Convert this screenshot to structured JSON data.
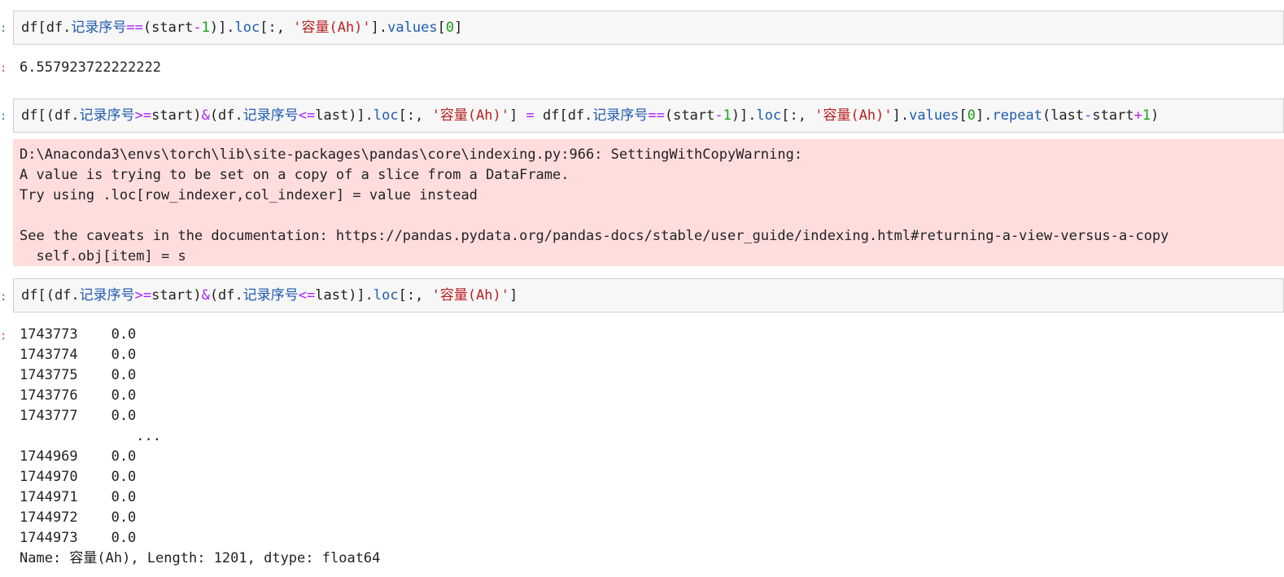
{
  "cells": [
    {
      "id": 1,
      "code_tokens": [
        {
          "t": "df[df.",
          "c": "nm"
        },
        {
          "t": "记录序号",
          "c": "at cjk"
        },
        {
          "t": "==",
          "c": "op"
        },
        {
          "t": "(start",
          "c": "nm"
        },
        {
          "t": "-",
          "c": "op"
        },
        {
          "t": "1",
          "c": "num"
        },
        {
          "t": ")].",
          "c": "nm"
        },
        {
          "t": "loc",
          "c": "at"
        },
        {
          "t": "[:, ",
          "c": "nm"
        },
        {
          "t": "'",
          "c": "str"
        },
        {
          "t": "容量",
          "c": "str cjk"
        },
        {
          "t": "(Ah)'",
          "c": "str"
        },
        {
          "t": "].",
          "c": "nm"
        },
        {
          "t": "values",
          "c": "at"
        },
        {
          "t": "[",
          "c": "nm"
        },
        {
          "t": "0",
          "c": "num"
        },
        {
          "t": "]",
          "c": "nm"
        }
      ],
      "output": "6.557923722222222"
    },
    {
      "id": 2,
      "code_tokens": [
        {
          "t": "df[(df.",
          "c": "nm"
        },
        {
          "t": "记录序号",
          "c": "at cjk"
        },
        {
          "t": ">=",
          "c": "op"
        },
        {
          "t": "start)",
          "c": "nm"
        },
        {
          "t": "&",
          "c": "op"
        },
        {
          "t": "(df.",
          "c": "nm"
        },
        {
          "t": "记录序号",
          "c": "at cjk"
        },
        {
          "t": "<=",
          "c": "op"
        },
        {
          "t": "last)].",
          "c": "nm"
        },
        {
          "t": "loc",
          "c": "at"
        },
        {
          "t": "[:, ",
          "c": "nm"
        },
        {
          "t": "'",
          "c": "str"
        },
        {
          "t": "容量",
          "c": "str cjk"
        },
        {
          "t": "(Ah)'",
          "c": "str"
        },
        {
          "t": "] ",
          "c": "nm"
        },
        {
          "t": "=",
          "c": "op"
        },
        {
          "t": " df[df.",
          "c": "nm"
        },
        {
          "t": "记录序号",
          "c": "at cjk"
        },
        {
          "t": "==",
          "c": "op"
        },
        {
          "t": "(start",
          "c": "nm"
        },
        {
          "t": "-",
          "c": "op"
        },
        {
          "t": "1",
          "c": "num"
        },
        {
          "t": ")].",
          "c": "nm"
        },
        {
          "t": "loc",
          "c": "at"
        },
        {
          "t": "[:, ",
          "c": "nm"
        },
        {
          "t": "'",
          "c": "str"
        },
        {
          "t": "容量",
          "c": "str cjk"
        },
        {
          "t": "(Ah)'",
          "c": "str"
        },
        {
          "t": "].",
          "c": "nm"
        },
        {
          "t": "values",
          "c": "at"
        },
        {
          "t": "[",
          "c": "nm"
        },
        {
          "t": "0",
          "c": "num"
        },
        {
          "t": "].",
          "c": "nm"
        },
        {
          "t": "repeat",
          "c": "fn"
        },
        {
          "t": "(last",
          "c": "nm"
        },
        {
          "t": "-",
          "c": "op"
        },
        {
          "t": "start",
          "c": "nm"
        },
        {
          "t": "+",
          "c": "op"
        },
        {
          "t": "1",
          "c": "num"
        },
        {
          "t": ")",
          "c": "nm"
        }
      ],
      "stderr_lines": [
        "D:\\Anaconda3\\envs\\torch\\lib\\site-packages\\pandas\\core\\indexing.py:966: SettingWithCopyWarning:",
        "A value is trying to be set on a copy of a slice from a DataFrame.",
        "Try using .loc[row_indexer,col_indexer] = value instead",
        "",
        "See the caveats in the documentation: https://pandas.pydata.org/pandas-docs/stable/user_guide/indexing.html#returning-a-view-versus-a-copy",
        "  self.obj[item] = s"
      ]
    },
    {
      "id": 3,
      "code_tokens": [
        {
          "t": "df[(df.",
          "c": "nm"
        },
        {
          "t": "记录序号",
          "c": "at cjk"
        },
        {
          "t": ">=",
          "c": "op"
        },
        {
          "t": "start)",
          "c": "nm"
        },
        {
          "t": "&",
          "c": "op"
        },
        {
          "t": "(df.",
          "c": "nm"
        },
        {
          "t": "记录序号",
          "c": "at cjk"
        },
        {
          "t": "<=",
          "c": "op"
        },
        {
          "t": "last)].",
          "c": "nm"
        },
        {
          "t": "loc",
          "c": "at"
        },
        {
          "t": "[:, ",
          "c": "nm"
        },
        {
          "t": "'",
          "c": "str"
        },
        {
          "t": "容量",
          "c": "str cjk"
        },
        {
          "t": "(Ah)'",
          "c": "str"
        },
        {
          "t": "]",
          "c": "nm"
        }
      ],
      "output_lines": [
        "1743773    0.0",
        "1743774    0.0",
        "1743775    0.0",
        "1743776    0.0",
        "1743777    0.0",
        "              ...",
        "1744969    0.0",
        "1744970    0.0",
        "1744971    0.0",
        "1744972    0.0",
        "1744973    0.0",
        "Name: 容量(Ah), Length: 1201, dtype: float64"
      ]
    }
  ],
  "prompt_char": ":"
}
